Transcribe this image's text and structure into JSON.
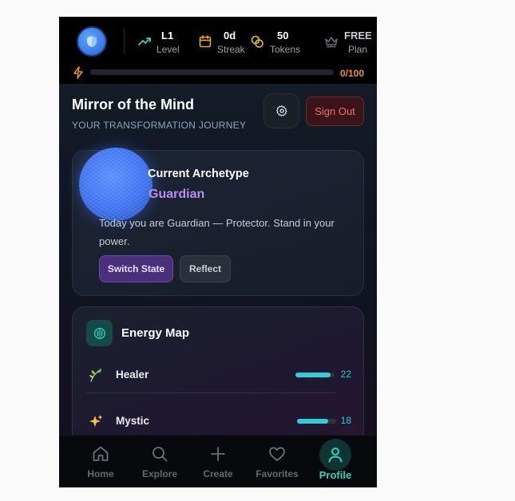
{
  "topbar": {
    "stats": [
      {
        "value": "L1",
        "label": "Level",
        "icon": "trending-up-icon"
      },
      {
        "value": "0d",
        "label": "Streak",
        "icon": "calendar-icon"
      },
      {
        "value": "50",
        "label": "Tokens",
        "icon": "coins-icon"
      },
      {
        "value": "FREE",
        "label": "Plan",
        "icon": "crown-icon"
      }
    ],
    "progress_text": "0/100",
    "progress_fraction": 0
  },
  "header": {
    "title": "Mirror of the Mind",
    "subtitle": "YOUR TRANSFORMATION JOURNEY",
    "signout_label": "Sign Out"
  },
  "archetype": {
    "label": "Current Archetype",
    "name": "Guardian",
    "description": "Today you are Guardian — Protector. Stand in your power.",
    "switch_label": "Switch State",
    "reflect_label": "Reflect"
  },
  "energy": {
    "title": "Energy Map",
    "items": [
      {
        "name": "Healer",
        "value": "22",
        "level": 0.9,
        "icon": "herb-icon"
      },
      {
        "name": "Mystic",
        "value": "18",
        "level": 0.8,
        "icon": "sparkles-icon"
      }
    ]
  },
  "nav": {
    "items": [
      {
        "label": "Home",
        "icon": "home-icon"
      },
      {
        "label": "Explore",
        "icon": "search-icon"
      },
      {
        "label": "Create",
        "icon": "plus-icon"
      },
      {
        "label": "Favorites",
        "icon": "heart-icon"
      },
      {
        "label": "Profile",
        "icon": "user-icon"
      }
    ],
    "active": "Profile"
  },
  "colors": {
    "accent_teal": "#2dd4bf",
    "progress_orange": "#f0a030",
    "archetype_purple": "#b98ef0",
    "signout_red": "#f07070"
  }
}
